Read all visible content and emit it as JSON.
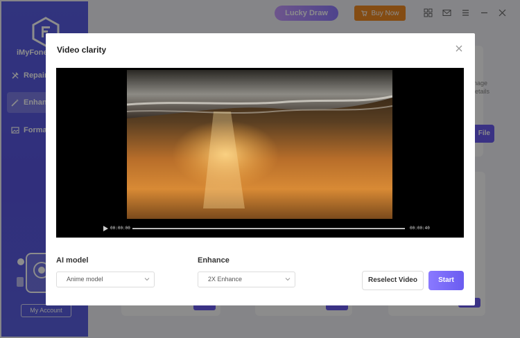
{
  "app": {
    "name": "iMyFone U",
    "nav": [
      {
        "label": "Repair",
        "icon": "wrench-icon"
      },
      {
        "label": "Enhanc",
        "icon": "magic-wand-icon"
      },
      {
        "label": "Format",
        "icon": "image-icon"
      }
    ],
    "account_label": "My Account"
  },
  "topbar": {
    "lucky_draw": "Lucky Draw",
    "buy_now": "Buy Now"
  },
  "background": {
    "snippet_line1": "nage",
    "snippet_line2": "letails",
    "open_file": "File"
  },
  "modal": {
    "title": "Video clarity",
    "player": {
      "time_start": "00:00:00",
      "time_end": "00:00:40",
      "progress": 0
    },
    "ai_model": {
      "label": "AI model",
      "value": "Anime model"
    },
    "enhance": {
      "label": "Enhance",
      "value": "2X Enhance"
    },
    "reselect_label": "Reselect Video",
    "start_label": "Start"
  },
  "colors": {
    "accent": "#6a5cf0",
    "sidebar": "#5a5fe6",
    "buy": "#f08a24"
  }
}
